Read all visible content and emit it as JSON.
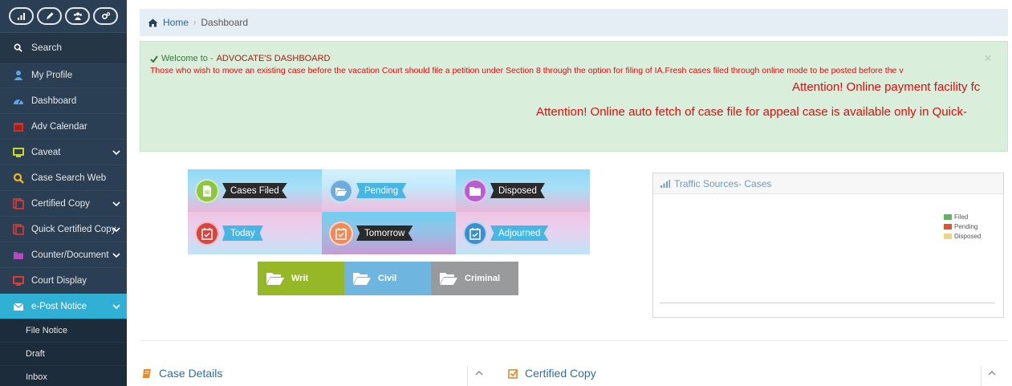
{
  "sidebar": {
    "shortcuts": [
      "stats-icon",
      "pencil-icon",
      "users-icon",
      "cogs-icon"
    ],
    "search_label": "Search",
    "items": [
      {
        "label": "My Profile",
        "icon": "user-icon",
        "color": "#5aa5e8"
      },
      {
        "label": "Dashboard",
        "icon": "dashboard-icon",
        "color": "#5aa5e8"
      },
      {
        "label": "Adv Calendar",
        "icon": "calendar-icon",
        "color": "#d9302c"
      },
      {
        "label": "Caveat",
        "icon": "monitor-icon",
        "color": "#c9d629"
      },
      {
        "label": "Case Search Web",
        "icon": "search-icon",
        "color": "#f0b429"
      },
      {
        "label": "Certified Copy",
        "icon": "copy-icon",
        "color": "#e23b2e"
      },
      {
        "label": "Quick Certified Copy",
        "icon": "copy-icon",
        "color": "#e23b2e"
      },
      {
        "label": "Counter/Document",
        "icon": "folder-icon",
        "color": "#b14dbf"
      },
      {
        "label": "Court Display",
        "icon": "monitor-icon",
        "color": "#e23b2e"
      },
      {
        "label": "e-Post Notice",
        "icon": "envelope-icon",
        "color": "#ffffff"
      }
    ],
    "subitems": [
      "File Notice",
      "Draft",
      "Inbox"
    ]
  },
  "breadcrumb": {
    "home": "Home",
    "separator": "›",
    "current": "Dashboard"
  },
  "alert": {
    "welcome_prefix": "Welcome to - ",
    "welcome_brand": "ADVOCATE'S DASHBOARD",
    "close": "×",
    "line1": "Those who wish to move an existing case before the vacation Court should file a petition under Section 8 through the option for filing of IA.Fresh cases filed through online mode to be posted before the v",
    "line2": "Attention! Online payment facility fc",
    "line3": "Attention! Online auto fetch of case file for appeal case is available only in Quick-"
  },
  "tiles": [
    {
      "label": "Cases Filed",
      "icon": "file-icon",
      "circle_color": "#8dc63f"
    },
    {
      "label": "Pending",
      "icon": "folder-open-icon",
      "circle_color": "#6aaee0"
    },
    {
      "label": "Disposed",
      "icon": "folder-icon",
      "circle_color": "#b85fd0"
    },
    {
      "label": "Today",
      "icon": "calendar-check-icon",
      "circle_color": "#d9443f"
    },
    {
      "label": "Tomorrow",
      "icon": "calendar-check-icon",
      "circle_color": "#f18a58"
    },
    {
      "label": "Adjourned",
      "icon": "calendar-check-icon",
      "circle_color": "#3a8fd0"
    }
  ],
  "categories": [
    {
      "label": "Writ",
      "icon": "folder-open-icon"
    },
    {
      "label": "Civil",
      "icon": "folder-open-icon"
    },
    {
      "label": "Criminal",
      "icon": "folder-open-icon"
    }
  ],
  "traffic": {
    "title": "Traffic Sources- Cases",
    "legend": [
      {
        "label": "Filed",
        "color": "#5cb85c"
      },
      {
        "label": "Pending",
        "color": "#e0542e"
      },
      {
        "label": "Disposed",
        "color": "#f4d67a"
      }
    ]
  },
  "panels": {
    "case_details": "Case Details",
    "certified_copy": "Certified Copy"
  }
}
